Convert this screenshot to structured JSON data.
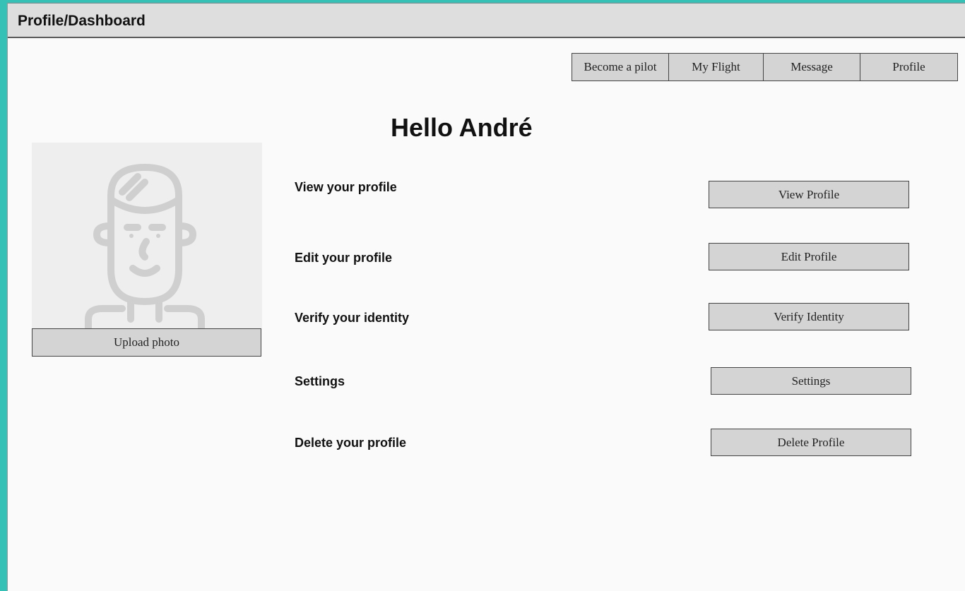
{
  "window": {
    "title": "Profile/Dashboard"
  },
  "nav": {
    "items": [
      "Become a pilot",
      "My Flight",
      "Message",
      "Profile"
    ]
  },
  "greeting": "Hello André",
  "avatar": {
    "upload_label": "Upload photo"
  },
  "actions": [
    {
      "label": "View your profile",
      "button": "View Profile"
    },
    {
      "label": "Edit your profile",
      "button": "Edit Profile"
    },
    {
      "label": "Verify your identity",
      "button": "Verify Identity"
    },
    {
      "label": "Settings",
      "button": "Settings"
    },
    {
      "label": "Delete your profile",
      "button": "Delete Profile"
    }
  ],
  "colors": {
    "background": "#35c1b5",
    "page": "#fafafa",
    "button": "#d4d4d4",
    "titlebar": "#dedede"
  }
}
